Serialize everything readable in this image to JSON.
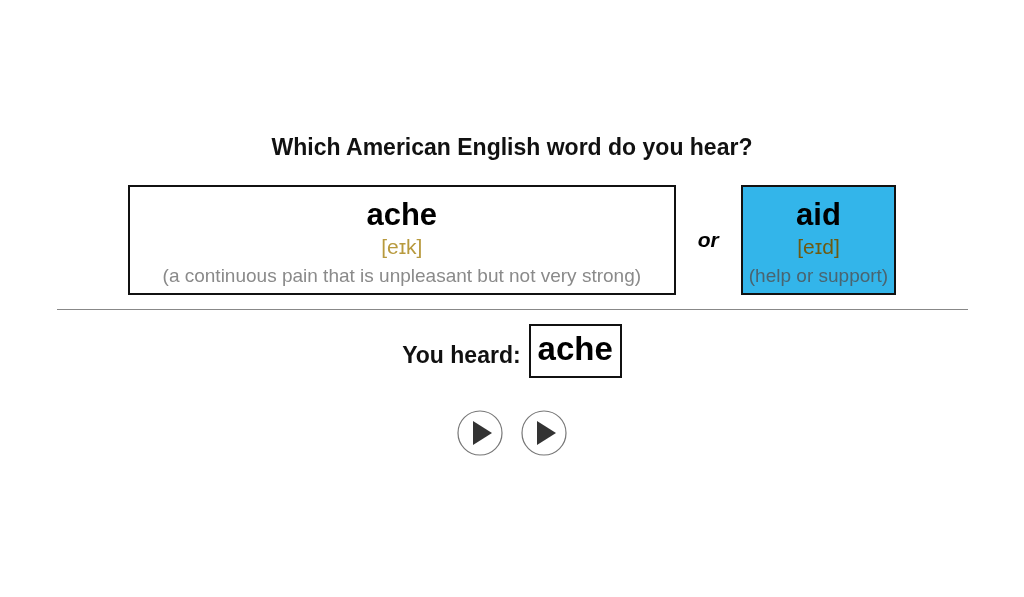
{
  "question": "Which American English word do you hear?",
  "options": [
    {
      "word": "ache",
      "phonetic": "[eɪk]",
      "meaning": "(a continuous pain that is unpleasant but not very strong)",
      "selected": false
    },
    {
      "word": "aid",
      "phonetic": "[eɪd]",
      "meaning": "(help or support)",
      "selected": true
    }
  ],
  "separator": "or",
  "result": {
    "label": "You heard:",
    "word": "ache"
  },
  "play_buttons": [
    {
      "kind": "play"
    },
    {
      "kind": "play"
    }
  ]
}
